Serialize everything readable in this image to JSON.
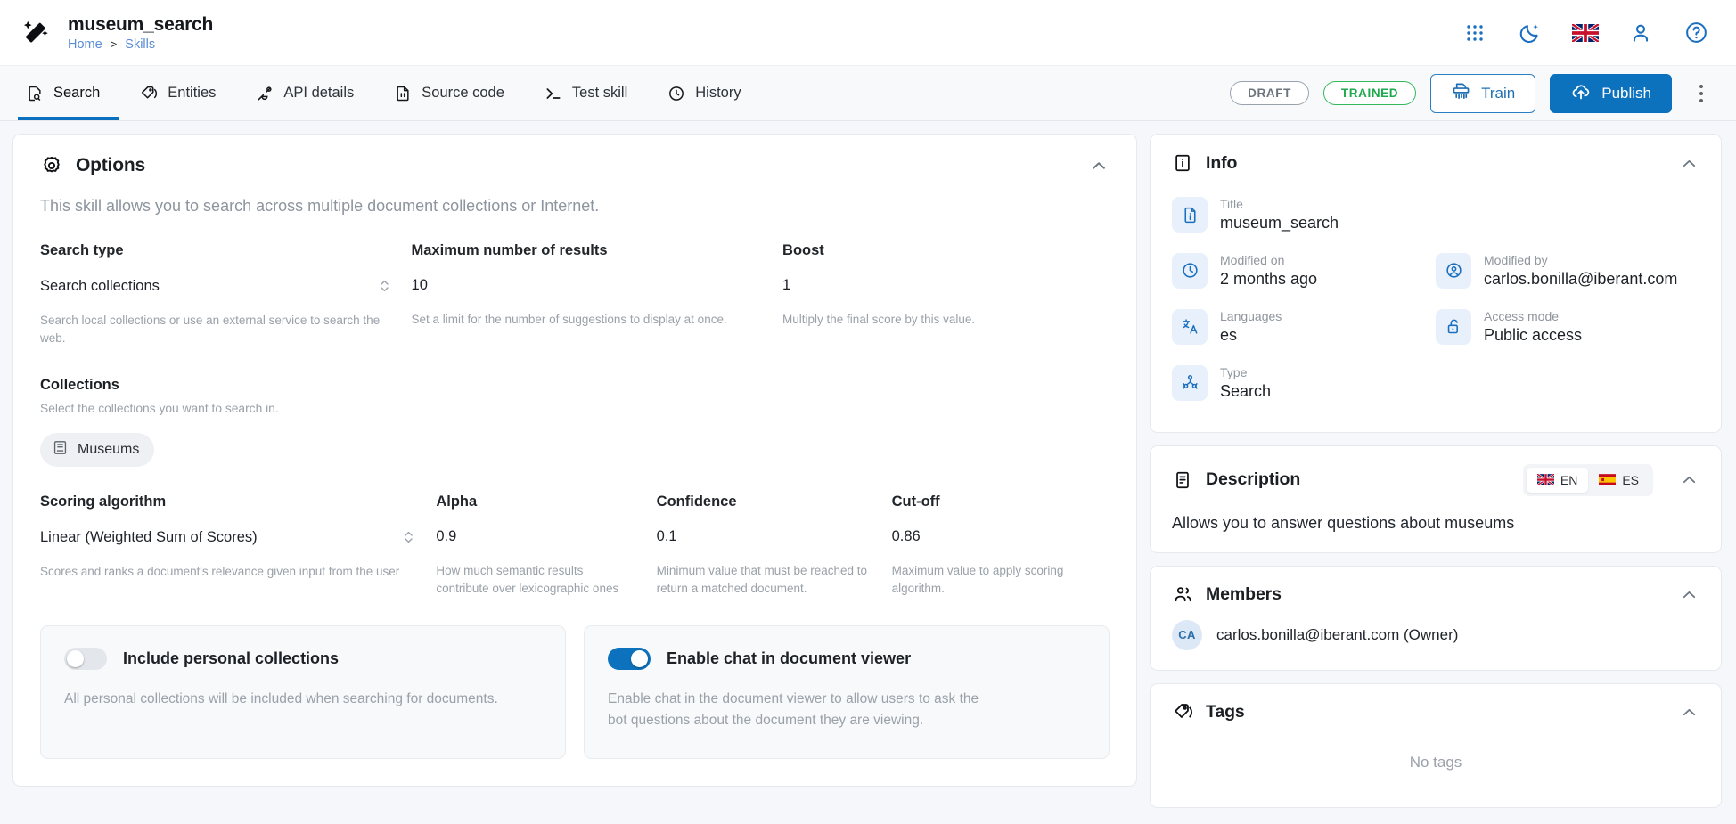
{
  "header": {
    "app_title": "museum_search",
    "logo_icon": "magic-wand-icon",
    "breadcrumbs": [
      {
        "label": "Home",
        "icon": ""
      },
      {
        "label": ">",
        "icon": ""
      },
      {
        "label": "Skills",
        "icon": ""
      }
    ],
    "icons": [
      {
        "name": "apps-grid-icon",
        "label": "Apps"
      },
      {
        "name": "dark-mode-moon-icon",
        "label": "Dark mode"
      },
      {
        "name": "language-flag-uk-icon",
        "label": "English"
      },
      {
        "name": "user-account-icon",
        "label": "Account"
      },
      {
        "name": "help-circle-icon",
        "label": "Help"
      }
    ]
  },
  "tabs": [
    {
      "label": "Search",
      "icon": "document-search-icon",
      "active": true
    },
    {
      "label": "Entities",
      "icon": "tag-entities-icon",
      "active": false
    },
    {
      "label": "API details",
      "icon": "plug-api-icon",
      "active": false
    },
    {
      "label": "Source code",
      "icon": "code-file-icon",
      "active": false
    },
    {
      "label": "Test skill",
      "icon": "terminal-prompt-icon",
      "active": false
    },
    {
      "label": "History",
      "icon": "clock-history-icon",
      "active": false
    }
  ],
  "actions": {
    "status_draft": "DRAFT",
    "status_trained": "TRAINED",
    "train_label": "Train",
    "train_icon": "shredder-train-icon",
    "publish_label": "Publish",
    "publish_icon": "cloud-upload-icon",
    "more_icon": "kebab-menu-icon"
  },
  "options": {
    "title": "Options",
    "icon": "gear-icon",
    "collapse_icon": "chevron-up-icon",
    "subtitle": "This skill allows you to search across multiple document collections or Internet.",
    "row1": [
      {
        "label": "Search type",
        "value": "Search collections",
        "help": "Search local collections or use an external service to search the web.",
        "is_select": true
      },
      {
        "label": "Maximum number of results",
        "value": "10",
        "help": "Set a limit for the number of suggestions to display at once.",
        "is_select": false
      },
      {
        "label": "Boost",
        "value": "1",
        "help": "Multiply the final score by this value.",
        "is_select": false
      }
    ],
    "collections": {
      "title": "Collections",
      "subtitle": "Select the collections you want to search in.",
      "chips": [
        {
          "label": "Museums",
          "icon": "book-collection-icon"
        }
      ]
    },
    "row2": [
      {
        "label": "Scoring algorithm",
        "value": "Linear (Weighted Sum of Scores)",
        "help": "Scores and ranks a document's relevance given input from the user",
        "is_select": true
      },
      {
        "label": "Alpha",
        "value": "0.9",
        "help": "How much semantic results contribute over lexicographic ones",
        "is_select": false
      },
      {
        "label": "Confidence",
        "value": "0.1",
        "help": "Minimum value that must be reached to return a matched document.",
        "is_select": false
      },
      {
        "label": "Cut-off",
        "value": "0.86",
        "help": "Maximum value to apply scoring algorithm.",
        "is_select": false
      }
    ],
    "toggles": [
      {
        "title": "Include personal collections",
        "description": "All personal collections will be included when searching for documents.",
        "state": "off"
      },
      {
        "title": "Enable chat in document viewer",
        "description": "Enable chat in the document viewer to allow users to ask the bot questions about the document they are viewing.",
        "state": "on"
      }
    ]
  },
  "info_panel": {
    "title": "Info",
    "icon": "info-square-icon",
    "collapse_icon": "chevron-up-icon",
    "items": [
      {
        "label": "Title",
        "value": "museum_search",
        "icon": "file-info-icon",
        "full": true
      },
      {
        "label": "Modified on",
        "value": "2 months ago",
        "icon": "clock-icon",
        "full": false
      },
      {
        "label": "Modified by",
        "value": "carlos.bonilla@iberant.com",
        "icon": "user-circle-icon",
        "full": false
      },
      {
        "label": "Languages",
        "value": "es",
        "icon": "translate-icon",
        "full": false
      },
      {
        "label": "Access mode",
        "value": "Public access",
        "icon": "unlock-icon",
        "full": false
      },
      {
        "label": "Type",
        "value": "Search",
        "icon": "skill-tree-icon",
        "full": false
      }
    ]
  },
  "description_panel": {
    "title": "Description",
    "icon": "description-doc-icon",
    "collapse_icon": "chevron-up-icon",
    "lang_buttons": [
      {
        "label": "EN",
        "flag": "flag-uk-icon",
        "active": true
      },
      {
        "label": "ES",
        "flag": "flag-es-icon",
        "active": false
      }
    ],
    "text": "Allows you to answer questions about museums"
  },
  "members_panel": {
    "title": "Members",
    "icon": "members-people-icon",
    "collapse_icon": "chevron-up-icon",
    "members": [
      {
        "initials": "CA",
        "name": "carlos.bonilla@iberant.com (Owner)"
      }
    ]
  },
  "tags_panel": {
    "title": "Tags",
    "icon": "tag-icon",
    "collapse_icon": "chevron-up-icon",
    "empty_text": "No tags"
  },
  "colors": {
    "accent": "#0d72bd",
    "link": "#5b8dd4",
    "trained_green": "#1fa94d",
    "muted": "#9aa1a9",
    "page_bg": "#f5f7fa"
  }
}
